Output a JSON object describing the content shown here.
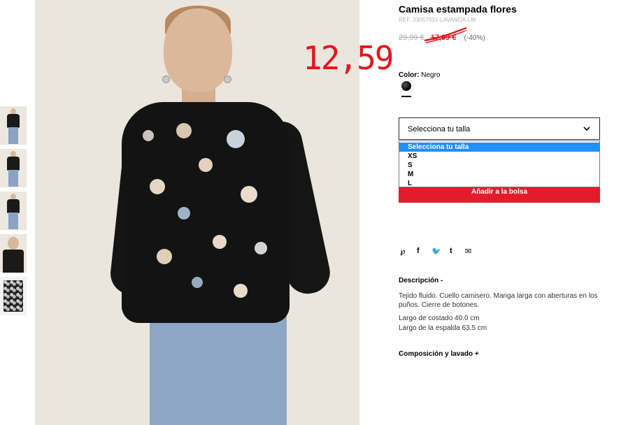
{
  "product": {
    "title": "Camisa estampada flores",
    "ref": "REF. 33057031-LAVANDA-LM",
    "old_price": "29,99 €",
    "sale_price": "17,99 €",
    "discount": "(-40%)"
  },
  "annotation": {
    "handwritten_price": "12,59",
    "color": "#e2161d"
  },
  "color": {
    "label": "Color:",
    "value": "Negro",
    "swatch": "#111111"
  },
  "size": {
    "placeholder": "Selecciona tu talla",
    "options": [
      "Selecciona tu talla",
      "XS",
      "S",
      "M",
      "L"
    ],
    "selected": "Selecciona tu talla"
  },
  "add_to_bag": "Añadir a la bolsa",
  "accent": "#e31c2b",
  "social": {
    "pinterest": "pinterest-icon",
    "facebook": "facebook-icon",
    "twitter": "twitter-icon",
    "tumblr": "tumblr-icon",
    "email": "email-icon"
  },
  "description": {
    "title": "Descripción -",
    "text": "Tejido fluido. Cuello camisero. Manga larga con aberturas en los puños. Cierre de botones.",
    "dim1": "Largo de costado 40.0 cm",
    "dim2": "Largo de la espalda 63.5 cm"
  },
  "composition": {
    "title": "Composición y lavado +"
  }
}
